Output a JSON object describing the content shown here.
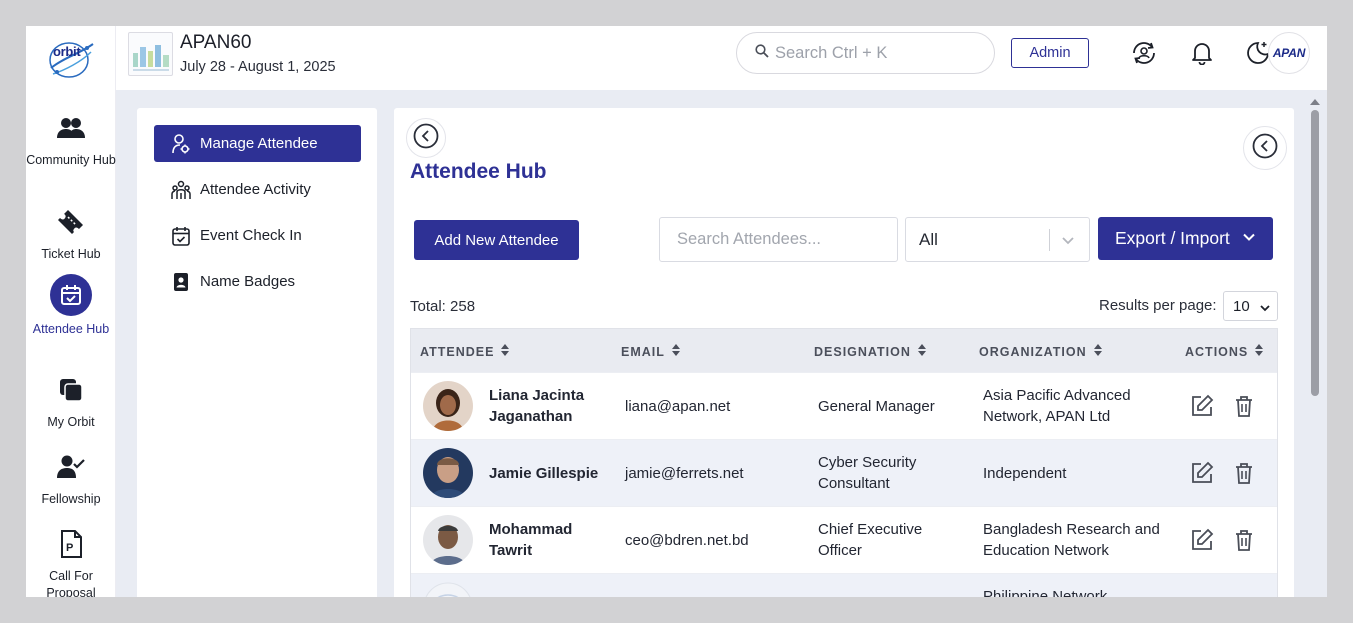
{
  "brand": {
    "logo_text": "orbit",
    "accent": "#2e3195"
  },
  "nav": [
    {
      "label": "Community Hub",
      "icon": "community-icon",
      "active": false
    },
    {
      "label": "Ticket Hub",
      "icon": "ticket-icon",
      "active": false
    },
    {
      "label": "Attendee Hub",
      "icon": "attendee-calendar-icon",
      "active": true
    },
    {
      "label": "My Orbit",
      "icon": "my-orbit-icon",
      "active": false
    },
    {
      "label": "Fellowship",
      "icon": "fellowship-icon",
      "active": false
    },
    {
      "label": "Call For Proposal",
      "icon": "proposal-icon",
      "active": false
    }
  ],
  "header": {
    "event_name": "APAN60",
    "event_dates": "July 28 - August 1, 2025",
    "search_placeholder": "Search  Ctrl + K",
    "admin_label": "Admin",
    "avatar_text": "APAN"
  },
  "submenu": [
    {
      "label": "Manage Attendee",
      "icon": "manage-attendee-icon",
      "active": true
    },
    {
      "label": "Attendee Activity",
      "icon": "activity-icon",
      "active": false
    },
    {
      "label": "Event Check In",
      "icon": "calendar-check-icon",
      "active": false
    },
    {
      "label": "Name Badges",
      "icon": "badge-icon",
      "active": false
    }
  ],
  "main": {
    "title": "Attendee Hub",
    "add_button": "Add New Attendee",
    "search_placeholder": "Search Attendees...",
    "filter_value": "All",
    "export_label": "Export / Import",
    "total_text": "Total: 258",
    "results_per_page_label": "Results per page:",
    "results_per_page_value": "10"
  },
  "table": {
    "columns": [
      "ATTENDEE",
      "EMAIL",
      "DESIGNATION",
      "ORGANIZATION",
      "ACTIONS"
    ],
    "rows": [
      {
        "name": "Liana Jacinta Jaganathan",
        "email": "liana@apan.net",
        "designation": "General Manager",
        "organization": "Asia Pacific Advanced Network, APAN Ltd"
      },
      {
        "name": "Jamie Gillespie",
        "email": "jamie@ferrets.net",
        "designation": "Cyber Security Consultant",
        "organization": "Independent"
      },
      {
        "name": "Mohammad Tawrit",
        "email": "ceo@bdren.net.bd",
        "designation": "Chief Executive Officer",
        "organization": "Bangladesh Research and Education Network"
      },
      {
        "name": "",
        "email": "",
        "designation": "",
        "organization": "Philippine Network"
      }
    ]
  }
}
